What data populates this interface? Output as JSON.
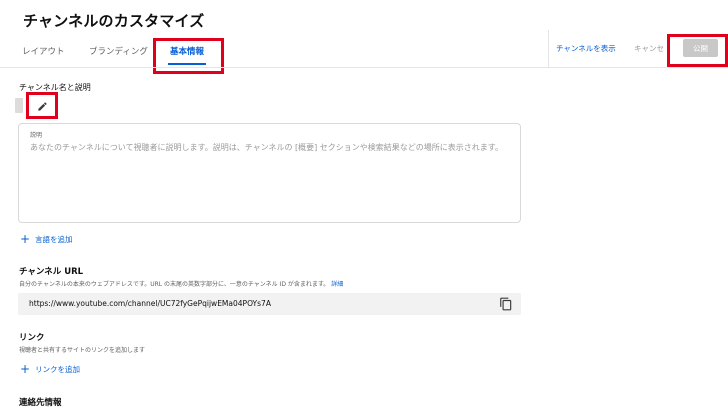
{
  "page": {
    "title": "チャンネルのカスタマイズ"
  },
  "tabs": [
    {
      "label": "レイアウト"
    },
    {
      "label": "ブランディング"
    },
    {
      "label": "基本情報"
    }
  ],
  "header_actions": {
    "view_channel": "チャンネルを表示",
    "cancel": "キャンセ",
    "publish": "公開"
  },
  "name_section": {
    "label": "チャンネル名と説明"
  },
  "description": {
    "label": "説明",
    "placeholder": "あなたのチャンネルについて視聴者に説明します。説明は、チャンネルの [概要] セクションや検索結果などの場所に表示されます。"
  },
  "add_language": {
    "label": "言語を追加"
  },
  "channel_url": {
    "label": "チャンネル URL",
    "helper": "自分のチャンネルの本来のウェブアドレスです。URL の末尾の英数字部分に、一意のチャンネル ID が含まれます。",
    "helper_link": "詳細",
    "url": "https://www.youtube.com/channel/UC72fyGePqijwEMa04POYs7A"
  },
  "links": {
    "label": "リンク",
    "helper": "視聴者と共有するサイトのリンクを追加します",
    "add_label": "リンクを追加"
  },
  "contact": {
    "label": "連絡先情報"
  },
  "colors": {
    "accent": "#065fd4",
    "highlight": "#e0001b",
    "publish_disabled": "#c8c8c8"
  }
}
